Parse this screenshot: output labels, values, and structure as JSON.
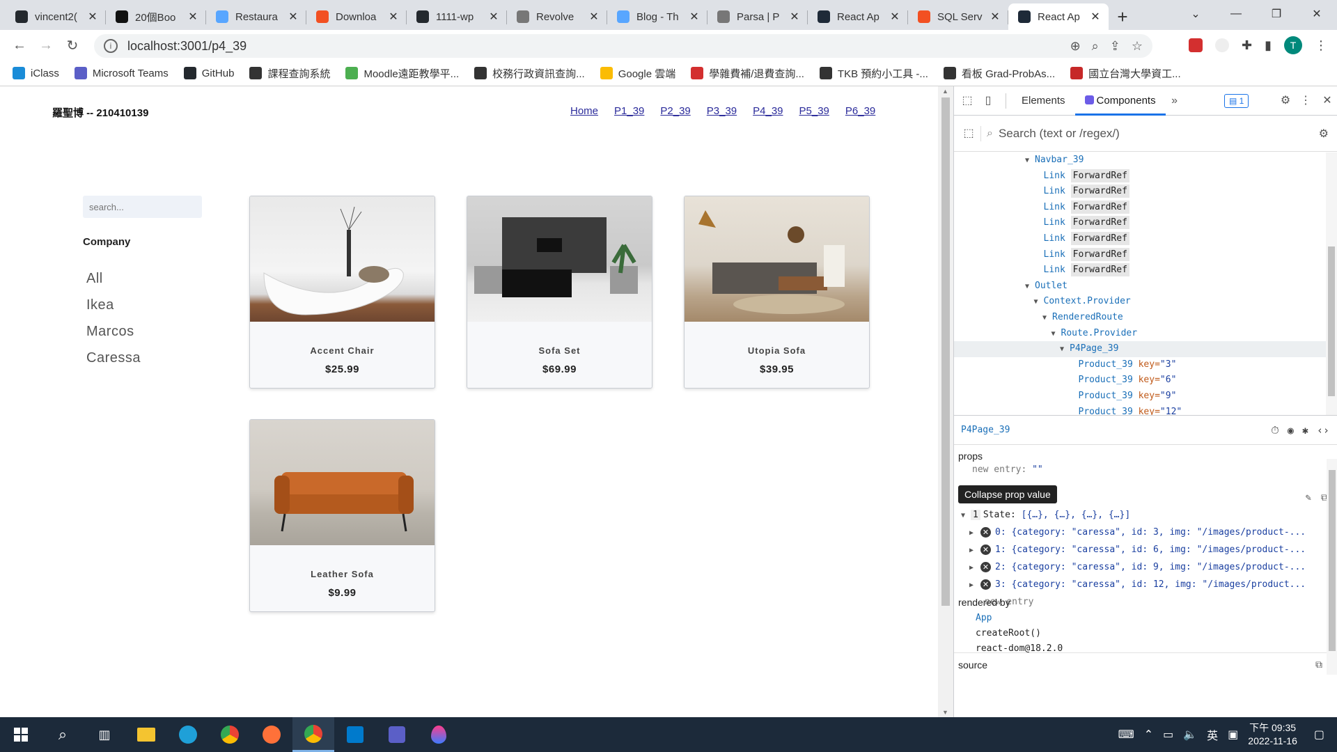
{
  "browser": {
    "tabs": [
      {
        "title": "vincent2(",
        "color": "#24292e"
      },
      {
        "title": "20個Boo",
        "color": "#111111"
      },
      {
        "title": "Restaura",
        "color": "#58a6ff"
      },
      {
        "title": "Downloa",
        "color": "#f25022"
      },
      {
        "title": "1111-wp",
        "color": "#24292e"
      },
      {
        "title": "Revolve",
        "color": "#777777"
      },
      {
        "title": "Blog - Th",
        "color": "#58a6ff"
      },
      {
        "title": "Parsa | P",
        "color": "#777777"
      },
      {
        "title": "React Ap",
        "color": "#1e2a38"
      },
      {
        "title": "SQL Serv",
        "color": "#f25022"
      },
      {
        "title": "React Ap",
        "color": "#1e2a38",
        "active": true
      }
    ],
    "new_tab_label": "+",
    "url": "localhost:3001/p4_39",
    "avatar_letter": "T",
    "bookmarks": [
      {
        "label": "iClass",
        "color": "#1a8cd8"
      },
      {
        "label": "Microsoft Teams",
        "color": "#5b5fc7"
      },
      {
        "label": "GitHub",
        "color": "#24292e"
      },
      {
        "label": "課程查詢系統",
        "color": "#333333"
      },
      {
        "label": "Moodle遠距教學平...",
        "color": "#4caf50"
      },
      {
        "label": "校務行政資訊查詢...",
        "color": "#333333"
      },
      {
        "label": "Google 雲端",
        "color": "#fbbc04"
      },
      {
        "label": "學雜費補/退費查詢...",
        "color": "#d32f2f"
      },
      {
        "label": "TKB 預約小工具 -...",
        "color": "#333333"
      },
      {
        "label": "看板 Grad-ProbAs...",
        "color": "#333333"
      },
      {
        "label": "國立台灣大學資工...",
        "color": "#c62828"
      }
    ]
  },
  "page": {
    "brand": "羅聖博 -- 210410139",
    "nav_links": [
      "Home",
      "P1_39",
      "P2_39",
      "P3_39",
      "P4_39",
      "P5_39",
      "P6_39"
    ],
    "search_placeholder": "search...",
    "company_heading": "Company",
    "categories": [
      "All",
      "Ikea",
      "Marcos",
      "Caressa"
    ],
    "products": [
      {
        "name": "Accent Chair",
        "price": "$25.99"
      },
      {
        "name": "Sofa Set",
        "price": "$69.99"
      },
      {
        "name": "Utopia Sofa",
        "price": "$39.95"
      },
      {
        "name": "Leather Sofa",
        "price": "$9.99"
      }
    ]
  },
  "devtools": {
    "tabs": [
      "Elements",
      "Components"
    ],
    "active_tab": "Components",
    "badge": "1",
    "search_placeholder": "Search (text or /regex/)",
    "tree": [
      {
        "indent": 0,
        "arrow": "▼",
        "name": "Navbar_39"
      },
      {
        "indent": 1,
        "name": "Link",
        "tag": "ForwardRef"
      },
      {
        "indent": 1,
        "name": "Link",
        "tag": "ForwardRef"
      },
      {
        "indent": 1,
        "name": "Link",
        "tag": "ForwardRef"
      },
      {
        "indent": 1,
        "name": "Link",
        "tag": "ForwardRef"
      },
      {
        "indent": 1,
        "name": "Link",
        "tag": "ForwardRef"
      },
      {
        "indent": 1,
        "name": "Link",
        "tag": "ForwardRef"
      },
      {
        "indent": 1,
        "name": "Link",
        "tag": "ForwardRef"
      },
      {
        "indent": 0,
        "arrow": "▼",
        "name": "Outlet"
      },
      {
        "indent": 1,
        "arrow": "▼",
        "name": "Context.Provider"
      },
      {
        "indent": 2,
        "arrow": "▼",
        "name": "RenderedRoute"
      },
      {
        "indent": 3,
        "arrow": "▼",
        "name": "Route.Provider"
      },
      {
        "indent": 4,
        "arrow": "▼",
        "name": "P4Page_39",
        "selected": true
      },
      {
        "indent": 5,
        "name": "Product_39",
        "key": "key=",
        "keyval": "\"3\""
      },
      {
        "indent": 5,
        "name": "Product_39",
        "key": "key=",
        "keyval": "\"6\""
      },
      {
        "indent": 5,
        "name": "Product_39",
        "key": "key=",
        "keyval": "\"9\""
      },
      {
        "indent": 5,
        "name": "Product_39",
        "key": "key=",
        "keyval": "\"12\""
      }
    ],
    "selected_component": "P4Page_39",
    "props_label": "props",
    "new_entry_prop": "new entry:",
    "new_entry_value": "\"\"",
    "tooltip": "Collapse prop value",
    "hooks_index": "1",
    "state_label": "State:",
    "state_summary": "[{…}, {…}, {…}, {…}]",
    "state_items": [
      "0: {category: \"caressa\", id: 3, img: \"/images/product-...",
      "1: {category: \"caressa\", id: 6, img: \"/images/product-...",
      "2: {category: \"caressa\", id: 9, img: \"/images/product-...",
      "3: {category: \"caressa\", id: 12, img: \"/images/product..."
    ],
    "new_entry": "new entry",
    "rendered_by_label": "rendered by",
    "rendered_by": [
      "App",
      "createRoot()",
      "react-dom@18.2.0"
    ],
    "source_label": "source"
  },
  "taskbar": {
    "time": "下午 09:35",
    "date": "2022-11-16",
    "ime": "英"
  }
}
